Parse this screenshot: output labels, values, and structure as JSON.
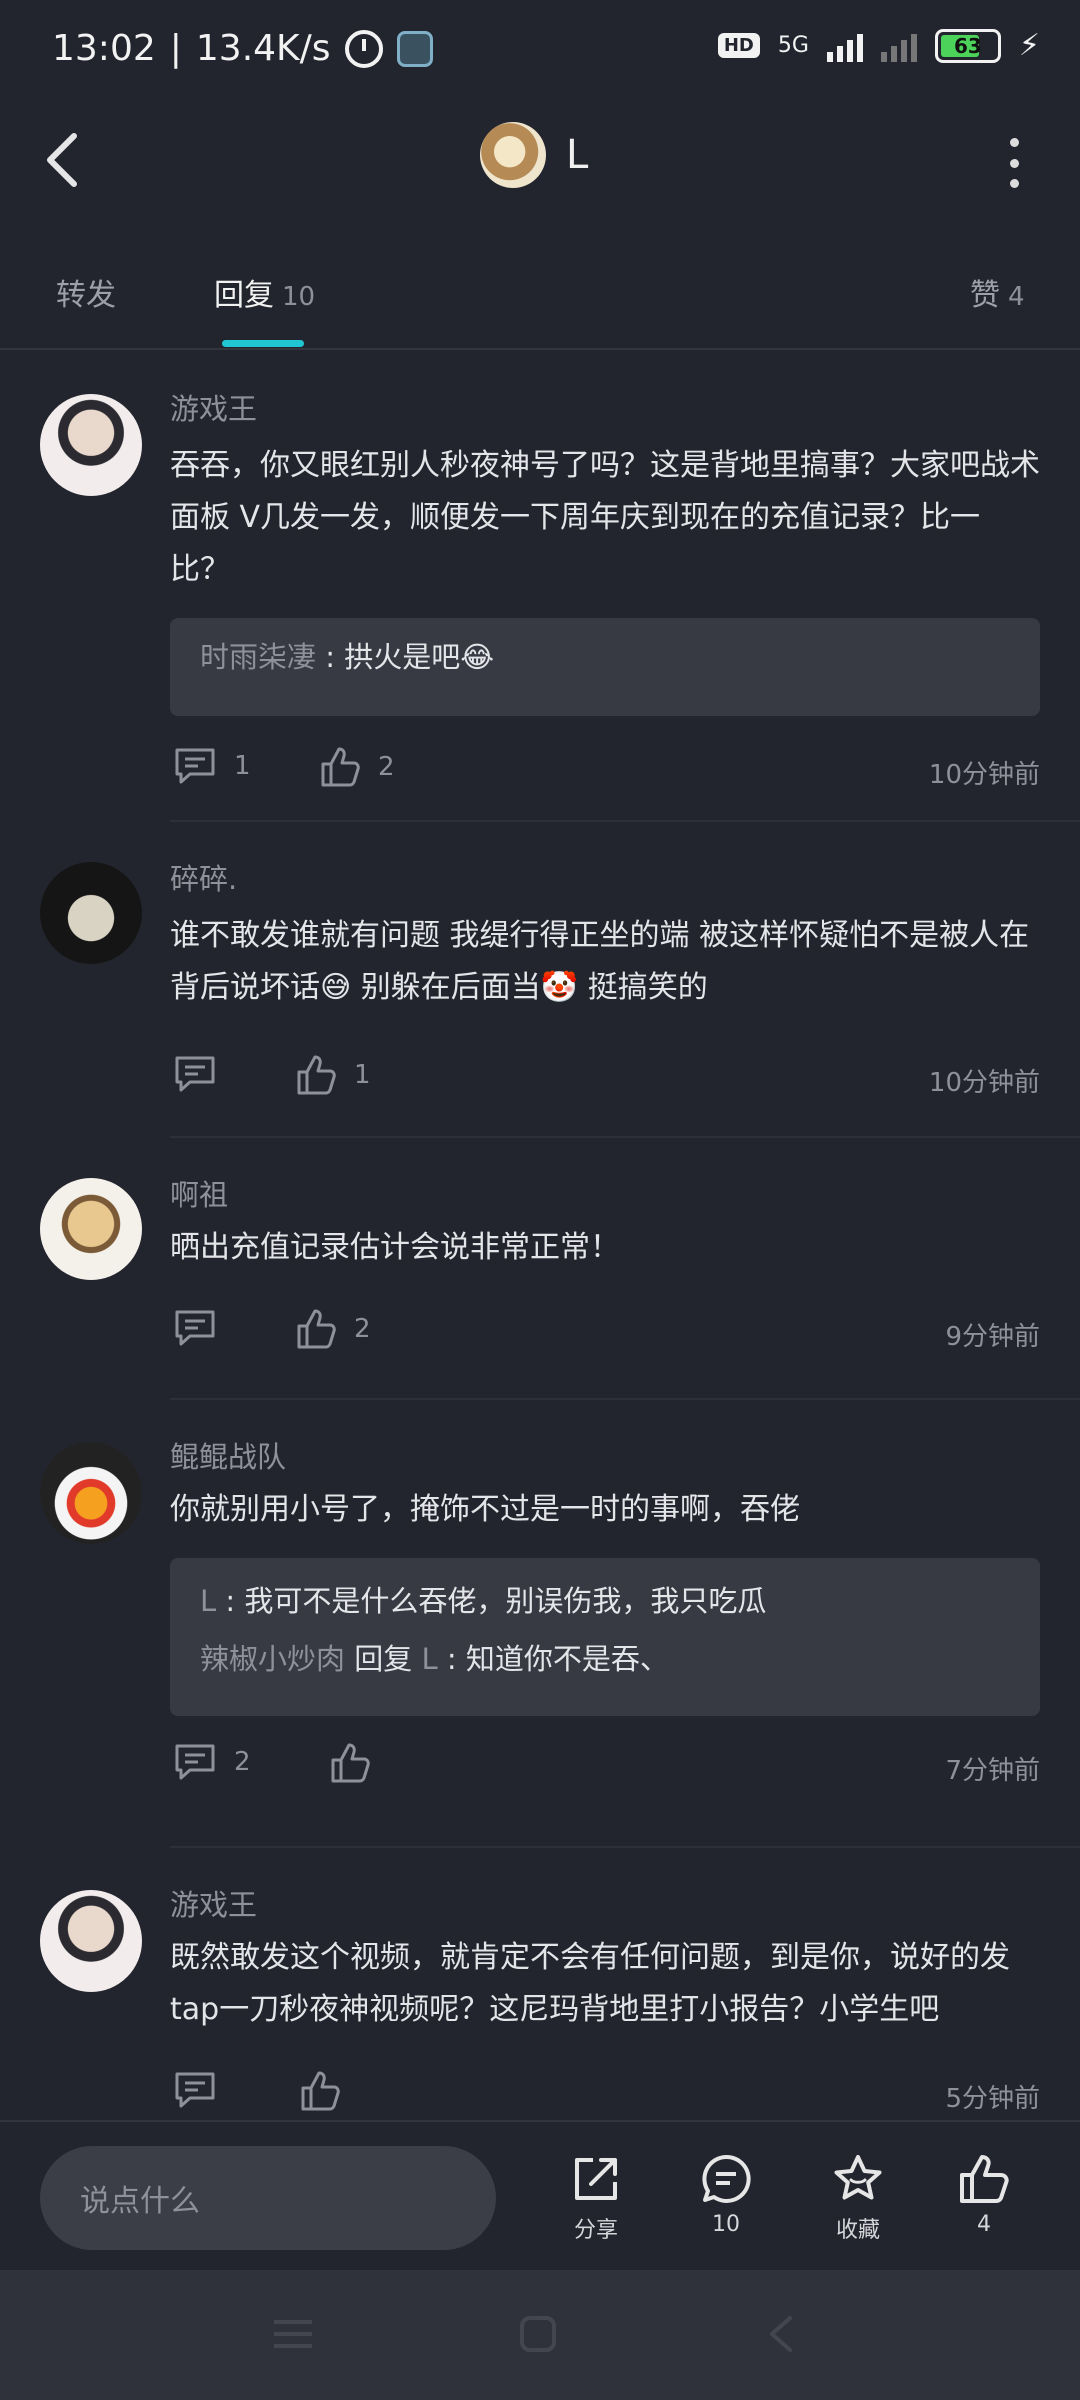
{
  "status_bar": {
    "time": "13:02",
    "speed": "13.4K/s",
    "hd": "HD",
    "network": "5G",
    "battery": "63"
  },
  "header": {
    "title": "L"
  },
  "tabs": [
    {
      "label": "转发",
      "count": ""
    },
    {
      "label": "回复",
      "count": "10"
    },
    {
      "label": "赞",
      "count": "4"
    }
  ],
  "comments": [
    {
      "user": "游戏王",
      "text": "吞吞，你又眼红别人秒夜神号了吗？这是背地里搞事？大家吧战术 面板 V几发一发，顺便发一下周年庆到现在的充值记录？比一比？",
      "quotes": [
        {
          "name": "时雨柒凄",
          "sep": " : ",
          "text": "拱火是吧😂"
        }
      ],
      "replies": "1",
      "likes": "2",
      "time": "10分钟前"
    },
    {
      "user": "碎碎.",
      "text": "谁不敢发谁就有问题  我缇行得正坐的端  被这样怀疑怕不是被人在背后说坏话😅  别躲在后面当🤡  挺搞笑的",
      "quotes": [],
      "replies": "",
      "likes": "1",
      "time": "10分钟前"
    },
    {
      "user": "啊祖",
      "text": "晒出充值记录估计会说非常正常！",
      "quotes": [],
      "replies": "",
      "likes": "2",
      "time": "9分钟前"
    },
    {
      "user": "鲲鲲战队",
      "text": "你就别用小号了，掩饰不过是一时的事啊，吞佬",
      "quotes": [
        {
          "name": "L",
          "sep": " : ",
          "text": "我可不是什么吞佬，别误伤我，我只吃瓜"
        },
        {
          "name": "辣椒小炒肉",
          "sep": " 回复 ",
          "name2": "L",
          "text": "知道你不是吞、"
        }
      ],
      "replies": "2",
      "likes": "",
      "time": "7分钟前"
    },
    {
      "user": "游戏王",
      "text": "既然敢发这个视频，就肯定不会有任何问题，到是你，说好的发tap一刀秒夜神视频呢？这尼玛背地里打小报告？小学生吧",
      "quotes": [],
      "replies": "",
      "likes": "",
      "time": "5分钟前"
    }
  ],
  "bottom_bar": {
    "input_placeholder": "说点什么",
    "share_label": "分享",
    "reply_count": "10",
    "favorite_label": "收藏",
    "like_count": "4"
  }
}
